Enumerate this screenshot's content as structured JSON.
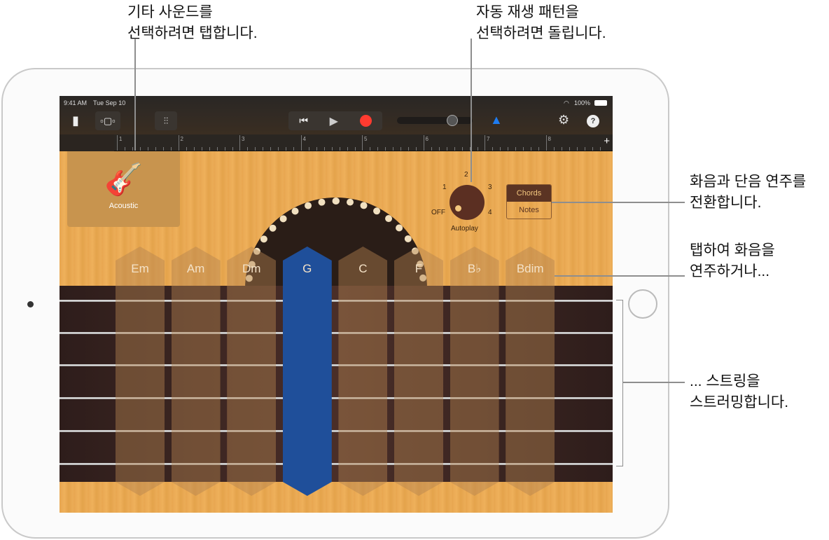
{
  "callouts": {
    "sound": [
      "기타 사운드를",
      "선택하려면 탭합니다."
    ],
    "autoplay": [
      "자동 재생 패턴을",
      "선택하려면 돌립니다."
    ],
    "toggle": [
      "화음과 단음 연주를",
      "전환합니다."
    ],
    "chords": [
      "탭하여 화음을",
      "연주하거나..."
    ],
    "strum": [
      "... 스트링을",
      "스트러밍합니다."
    ]
  },
  "status": {
    "time": "9:41 AM",
    "date": "Tue Sep 10",
    "battery": "100%"
  },
  "toolbar": {
    "icons": [
      "document-icon",
      "tracks-view-icon",
      "mixer-icon",
      "go-to-start-icon",
      "play-icon",
      "record-icon",
      "metronome-icon",
      "settings-icon",
      "help-icon"
    ],
    "record_color": "#ff3b30",
    "metronome_color": "#1e7cf0"
  },
  "ruler": {
    "bars": [
      "1",
      "2",
      "3",
      "4",
      "5",
      "6",
      "7",
      "8"
    ],
    "add": "+"
  },
  "instrument": {
    "name": "Acoustic"
  },
  "autoplay": {
    "label": "Autoplay",
    "positions": [
      "OFF",
      "1",
      "2",
      "3",
      "4"
    ],
    "value": "OFF"
  },
  "mode": {
    "options": [
      "Chords",
      "Notes"
    ],
    "selected": "Chords"
  },
  "chords": [
    {
      "label": "Em"
    },
    {
      "label": "Am"
    },
    {
      "label": "Dm"
    },
    {
      "label": "G",
      "selected": true
    },
    {
      "label": "C"
    },
    {
      "label": "F"
    },
    {
      "label": "B♭"
    },
    {
      "label": "Bdim"
    }
  ],
  "colors": {
    "selected_chord": "#1f4f9a",
    "wood": "#e8a650"
  }
}
